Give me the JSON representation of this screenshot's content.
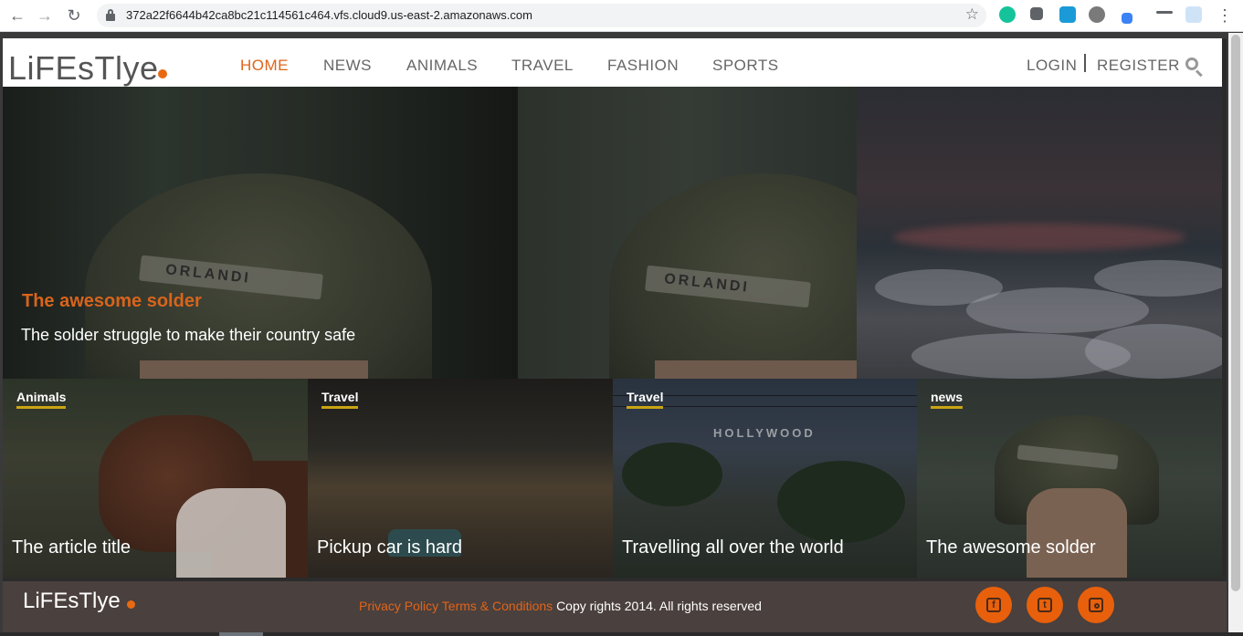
{
  "browser": {
    "url": "372a22f6644b42ca8bc21c114561c464.vfs.cloud9.us-east-2.amazonaws.com",
    "back_glyph": "←",
    "forward_glyph": "→",
    "reload_glyph": "↻",
    "star_glyph": "☆",
    "menu_glyph": "⋮"
  },
  "header": {
    "logo": "LiFEsTlye",
    "nav": [
      "HOME",
      "NEWS",
      "ANIMALS",
      "TRAVEL",
      "FASHION",
      "SPORTS"
    ],
    "active": "HOME",
    "login": "LOGIN",
    "register": "REGISTER"
  },
  "hero": {
    "title": "The awesome solder",
    "subtitle": "The solder struggle to make their country safe",
    "helmet_text": "ORLANDI"
  },
  "cards": [
    {
      "tag": "Animals",
      "title": "The article title"
    },
    {
      "tag": "Travel",
      "title": "Pickup car is hard"
    },
    {
      "tag": "Travel",
      "title": "Travelling all over the world",
      "sign": "HOLLYWOOD"
    },
    {
      "tag": "news",
      "title": "The awesome solder"
    }
  ],
  "footer": {
    "logo": "LiFEsTlye",
    "privacy": "Privacy Policy",
    "terms": "Terms & Conditions",
    "copyright": "Copy rights 2014. All rights reserved",
    "social": [
      "facebook-icon",
      "twitter-icon",
      "instagram-icon"
    ]
  },
  "colors": {
    "accent": "#e0641a",
    "tag_underline": "#c9a514",
    "footer_bg": "#4a403d"
  }
}
